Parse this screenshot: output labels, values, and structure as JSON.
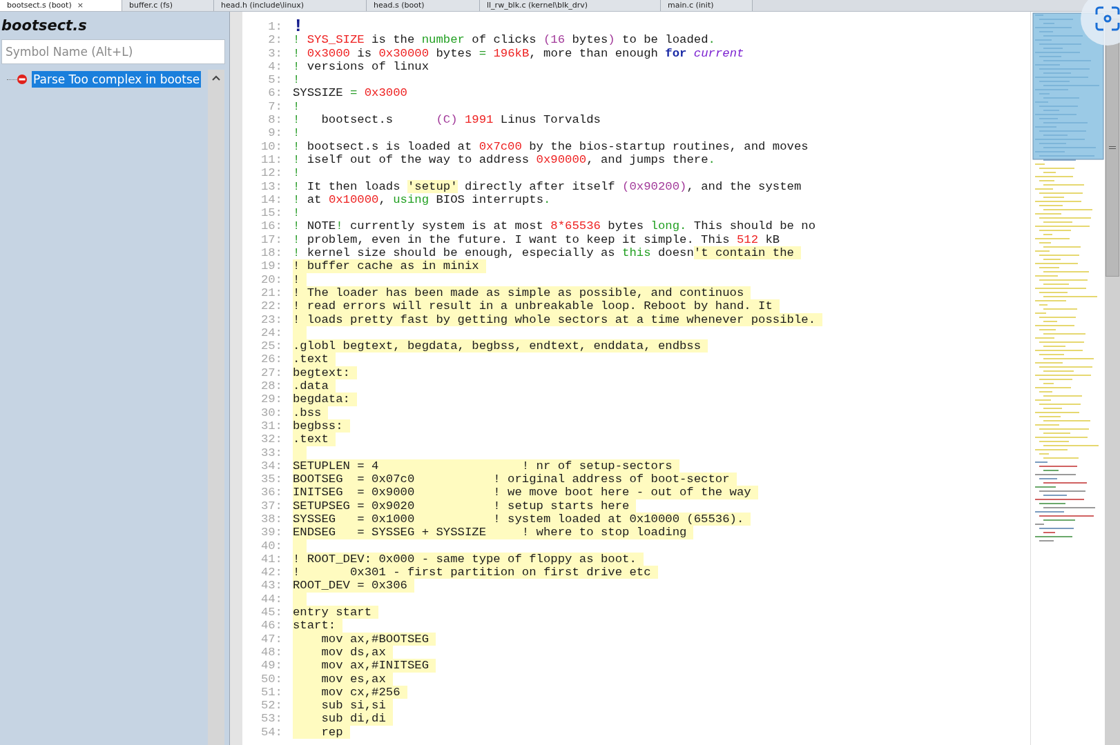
{
  "tabs": [
    {
      "label": "bootsect.s (boot)",
      "selected": true,
      "close": "×"
    },
    {
      "label": "buffer.c (fs)",
      "selected": false
    },
    {
      "label": "head.h (include\\linux)",
      "selected": false
    },
    {
      "label": "head.s (boot)",
      "selected": false
    },
    {
      "label": "ll_rw_blk.c (kernel\\blk_drv)",
      "selected": false
    },
    {
      "label": "main.c (init)",
      "selected": false
    }
  ],
  "symbol_panel": {
    "title": "bootsect.s",
    "search": {
      "placeholder": "Symbol Name (Alt+L)"
    },
    "tree": [
      {
        "label": "Parse Too complex in bootse",
        "selected": true,
        "kind": "error"
      }
    ]
  },
  "editor": {
    "lines": [
      {
        "number": "1:",
        "kind": "code",
        "segments": [
          {
            "text": "!",
            "kind": "big-bang"
          }
        ]
      },
      {
        "number": "2:",
        "kind": "code",
        "segments": [
          {
            "text": "! ",
            "kind": "comment"
          },
          {
            "text": "SYS_SIZE",
            "kind": "number"
          },
          {
            "text": " is the ",
            "kind": "plain"
          },
          {
            "text": "number",
            "kind": "keyword"
          },
          {
            "text": " of clicks ",
            "kind": "plain"
          },
          {
            "text": "(16",
            "kind": "punct"
          },
          {
            "text": " bytes",
            "kind": "plain"
          },
          {
            "text": ")",
            "kind": "punct"
          },
          {
            "text": " to be loaded",
            "kind": "plain"
          },
          {
            "text": ".",
            "kind": "comment"
          }
        ]
      },
      {
        "number": "3:",
        "kind": "code",
        "segments": [
          {
            "text": "! ",
            "kind": "comment"
          },
          {
            "text": "0x3000",
            "kind": "number"
          },
          {
            "text": " is ",
            "kind": "plain"
          },
          {
            "text": "0x30000",
            "kind": "number"
          },
          {
            "text": " bytes ",
            "kind": "plain"
          },
          {
            "text": "= ",
            "kind": "comment"
          },
          {
            "text": "196kB",
            "kind": "number"
          },
          {
            "text": ", more than enough ",
            "kind": "plain"
          },
          {
            "text": "for",
            "kind": "bold-keyword"
          },
          {
            "text": " current",
            "kind": "italic-keyword"
          }
        ]
      },
      {
        "number": "4:",
        "kind": "code",
        "segments": [
          {
            "text": "! ",
            "kind": "comment"
          },
          {
            "text": "versions of linux",
            "kind": "plain"
          }
        ]
      },
      {
        "number": "5:",
        "kind": "code",
        "segments": [
          {
            "text": "!",
            "kind": "comment"
          }
        ]
      },
      {
        "number": "6:",
        "kind": "code",
        "segments": [
          {
            "text": "SYSSIZE ",
            "kind": "plain"
          },
          {
            "text": "= ",
            "kind": "comment"
          },
          {
            "text": "0x3000",
            "kind": "number"
          }
        ]
      },
      {
        "number": "7:",
        "kind": "code",
        "segments": [
          {
            "text": "!",
            "kind": "comment"
          }
        ]
      },
      {
        "number": "8:",
        "kind": "code",
        "segments": [
          {
            "text": "!   ",
            "kind": "comment"
          },
          {
            "text": "bootsect.s      ",
            "kind": "plain"
          },
          {
            "text": "(C) ",
            "kind": "punct"
          },
          {
            "text": "1991",
            "kind": "number"
          },
          {
            "text": " Linus Torvalds",
            "kind": "plain"
          }
        ]
      },
      {
        "number": "9:",
        "kind": "code",
        "segments": [
          {
            "text": "!",
            "kind": "comment"
          }
        ]
      },
      {
        "number": "10:",
        "kind": "code",
        "segments": [
          {
            "text": "! ",
            "kind": "comment"
          },
          {
            "text": "bootsect.s is loaded at ",
            "kind": "plain"
          },
          {
            "text": "0x7c00",
            "kind": "number"
          },
          {
            "text": " by the bios-startup routines, and moves",
            "kind": "plain"
          }
        ]
      },
      {
        "number": "11:",
        "kind": "code",
        "segments": [
          {
            "text": "! ",
            "kind": "comment"
          },
          {
            "text": "iself out of the way to address ",
            "kind": "plain"
          },
          {
            "text": "0x90000",
            "kind": "number"
          },
          {
            "text": ", and jumps there",
            "kind": "plain"
          },
          {
            "text": ".",
            "kind": "comment"
          }
        ]
      },
      {
        "number": "12:",
        "kind": "code",
        "segments": [
          {
            "text": "!",
            "kind": "comment"
          }
        ]
      },
      {
        "number": "13:",
        "kind": "code",
        "segments": [
          {
            "text": "! ",
            "kind": "comment"
          },
          {
            "text": "It then loads ",
            "kind": "plain"
          },
          {
            "text": "'setup'",
            "kind": "string"
          },
          {
            "text": " directly after itself ",
            "kind": "plain"
          },
          {
            "text": "(0x90200)",
            "kind": "punct"
          },
          {
            "text": ", and the system",
            "kind": "plain"
          }
        ]
      },
      {
        "number": "14:",
        "kind": "code",
        "segments": [
          {
            "text": "! ",
            "kind": "comment"
          },
          {
            "text": "at ",
            "kind": "plain"
          },
          {
            "text": "0x10000",
            "kind": "number"
          },
          {
            "text": ", ",
            "kind": "plain"
          },
          {
            "text": "using",
            "kind": "keyword"
          },
          {
            "text": " BIOS interrupts",
            "kind": "plain"
          },
          {
            "text": ".",
            "kind": "comment"
          }
        ]
      },
      {
        "number": "15:",
        "kind": "code",
        "segments": [
          {
            "text": "!",
            "kind": "comment"
          }
        ]
      },
      {
        "number": "16:",
        "kind": "code",
        "segments": [
          {
            "text": "! ",
            "kind": "comment"
          },
          {
            "text": "NOTE",
            "kind": "plain"
          },
          {
            "text": "!",
            "kind": "comment"
          },
          {
            "text": " currently system is at most ",
            "kind": "plain"
          },
          {
            "text": "8*65536",
            "kind": "number"
          },
          {
            "text": " bytes ",
            "kind": "plain"
          },
          {
            "text": "long.",
            "kind": "keyword"
          },
          {
            "text": " This should be no",
            "kind": "plain"
          }
        ]
      },
      {
        "number": "17:",
        "kind": "code",
        "segments": [
          {
            "text": "! ",
            "kind": "comment"
          },
          {
            "text": "problem, even in the future. I want to keep it simple. This ",
            "kind": "plain"
          },
          {
            "text": "512",
            "kind": "number"
          },
          {
            "text": " kB",
            "kind": "plain"
          }
        ]
      },
      {
        "number": "18:",
        "kind": "code",
        "segments": [
          {
            "text": "! ",
            "kind": "comment"
          },
          {
            "text": "kernel size should be enough, especially as ",
            "kind": "plain"
          },
          {
            "text": "this",
            "kind": "keyword"
          },
          {
            "text": " doesn",
            "kind": "plain"
          },
          {
            "text": "'t contain the",
            "kind": "string-open"
          }
        ]
      },
      {
        "number": "19:",
        "kind": "string",
        "text": "! buffer cache as in minix"
      },
      {
        "number": "20:",
        "kind": "string",
        "text": "!"
      },
      {
        "number": "21:",
        "kind": "string",
        "text": "! The loader has been made as simple as possible, and continuos"
      },
      {
        "number": "22:",
        "kind": "string",
        "text": "! read errors will result in a unbreakable loop. Reboot by hand. It"
      },
      {
        "number": "23:",
        "kind": "string",
        "text": "! loads pretty fast by getting whole sectors at a time whenever possible."
      },
      {
        "number": "24:",
        "kind": "string"
      },
      {
        "number": "25:",
        "kind": "string",
        "text": ".globl begtext, begdata, begbss, endtext, enddata, endbss"
      },
      {
        "number": "26:",
        "kind": "string",
        "text": ".text"
      },
      {
        "number": "27:",
        "kind": "string",
        "text": "begtext:"
      },
      {
        "number": "28:",
        "kind": "string",
        "text": ".data"
      },
      {
        "number": "29:",
        "kind": "string",
        "text": "begdata:"
      },
      {
        "number": "30:",
        "kind": "string",
        "text": ".bss"
      },
      {
        "number": "31:",
        "kind": "string",
        "text": "begbss:"
      },
      {
        "number": "32:",
        "kind": "string",
        "text": ".text"
      },
      {
        "number": "33:",
        "kind": "string"
      },
      {
        "number": "34:",
        "kind": "string",
        "text": "SETUPLEN = 4                    ! nr of setup-sectors"
      },
      {
        "number": "35:",
        "kind": "string",
        "text": "BOOTSEG  = 0x07c0           ! original address of boot-sector"
      },
      {
        "number": "36:",
        "kind": "string",
        "text": "INITSEG  = 0x9000           ! we move boot here - out of the way"
      },
      {
        "number": "37:",
        "kind": "string",
        "text": "SETUPSEG = 0x9020           ! setup starts here"
      },
      {
        "number": "38:",
        "kind": "string",
        "text": "SYSSEG   = 0x1000           ! system loaded at 0x10000 (65536)."
      },
      {
        "number": "39:",
        "kind": "string",
        "text": "ENDSEG   = SYSSEG + SYSSIZE     ! where to stop loading"
      },
      {
        "number": "40:",
        "kind": "string"
      },
      {
        "number": "41:",
        "kind": "string",
        "text": "! ROOT_DEV: 0x000 - same type of floppy as boot."
      },
      {
        "number": "42:",
        "kind": "string",
        "text": "!       0x301 - first partition on first drive etc"
      },
      {
        "number": "43:",
        "kind": "string",
        "text": "ROOT_DEV = 0x306"
      },
      {
        "number": "44:",
        "kind": "string"
      },
      {
        "number": "45:",
        "kind": "string",
        "text": "entry start"
      },
      {
        "number": "46:",
        "kind": "string",
        "text": "start:"
      },
      {
        "number": "47:",
        "kind": "string",
        "text": "    mov ax,#BOOTSEG"
      },
      {
        "number": "48:",
        "kind": "string",
        "text": "    mov ds,ax"
      },
      {
        "number": "49:",
        "kind": "string",
        "text": "    mov ax,#INITSEG"
      },
      {
        "number": "50:",
        "kind": "string",
        "text": "    mov es,ax"
      },
      {
        "number": "51:",
        "kind": "string",
        "text": "    mov cx,#256"
      },
      {
        "number": "52:",
        "kind": "string",
        "text": "    sub si,si"
      },
      {
        "number": "53:",
        "kind": "string",
        "text": "    sub di,di"
      },
      {
        "number": "54:",
        "kind": "string",
        "text": "    rep"
      }
    ]
  }
}
